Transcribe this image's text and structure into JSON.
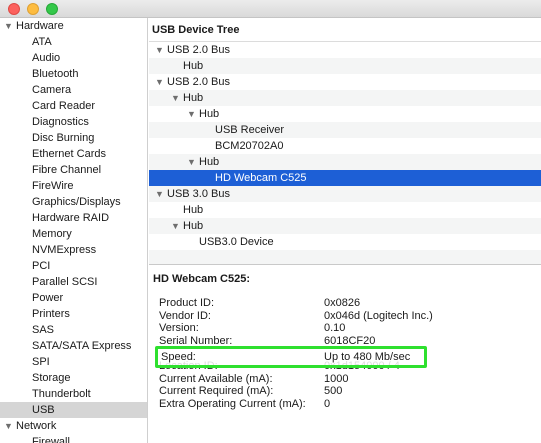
{
  "sidebar": {
    "groups": [
      {
        "label": "Hardware",
        "disclosure": "▼",
        "items": [
          "ATA",
          "Audio",
          "Bluetooth",
          "Camera",
          "Card Reader",
          "Diagnostics",
          "Disc Burning",
          "Ethernet Cards",
          "Fibre Channel",
          "FireWire",
          "Graphics/Displays",
          "Hardware RAID",
          "Memory",
          "NVMExpress",
          "PCI",
          "Parallel SCSI",
          "Power",
          "Printers",
          "SAS",
          "SATA/SATA Express",
          "SPI",
          "Storage",
          "Thunderbolt",
          "USB"
        ],
        "selected": "USB"
      },
      {
        "label": "Network",
        "disclosure": "▼",
        "items": [
          "Firewall"
        ]
      }
    ]
  },
  "tree": {
    "header": "USB Device Tree",
    "rows": [
      {
        "label": "USB 2.0 Bus",
        "disclosure": "▼",
        "level": 0
      },
      {
        "label": "Hub",
        "disclosure": "",
        "level": 1
      },
      {
        "label": "USB 2.0 Bus",
        "disclosure": "▼",
        "level": 0
      },
      {
        "label": "Hub",
        "disclosure": "▼",
        "level": 1
      },
      {
        "label": "Hub",
        "disclosure": "▼",
        "level": 2
      },
      {
        "label": "USB Receiver",
        "disclosure": "",
        "level": 3
      },
      {
        "label": "BCM20702A0",
        "disclosure": "",
        "level": 3
      },
      {
        "label": "Hub",
        "disclosure": "▼",
        "level": 2
      },
      {
        "label": "HD Webcam C525",
        "disclosure": "",
        "level": 3,
        "selected": true
      },
      {
        "label": "USB 3.0 Bus",
        "disclosure": "▼",
        "level": 0
      },
      {
        "label": "Hub",
        "disclosure": "",
        "level": 1
      },
      {
        "label": "Hub",
        "disclosure": "▼",
        "level": 1
      },
      {
        "label": "USB3.0 Device",
        "disclosure": "",
        "level": 2
      }
    ]
  },
  "detail": {
    "title": "HD Webcam C525:",
    "properties": [
      {
        "key": "Product ID:",
        "value": "0x0826"
      },
      {
        "key": "Vendor ID:",
        "value": "0x046d  (Logitech Inc.)"
      },
      {
        "key": "Version:",
        "value": "0.10"
      },
      {
        "key": "Serial Number:",
        "value": "6018CF20"
      },
      {
        "key": "Speed:",
        "value": "Up to 480 Mb/sec",
        "highlighted": true
      },
      {
        "key": "Location ID:",
        "value": "0x1d154000 / 4"
      },
      {
        "key": "Current Available (mA):",
        "value": "1000"
      },
      {
        "key": "Current Required (mA):",
        "value": "500"
      },
      {
        "key": "Extra Operating Current (mA):",
        "value": "0"
      }
    ]
  },
  "colors": {
    "selection": "#1d5fd6",
    "sidebar_selection": "#d5d5d5",
    "highlight_box": "#2ee02e"
  }
}
